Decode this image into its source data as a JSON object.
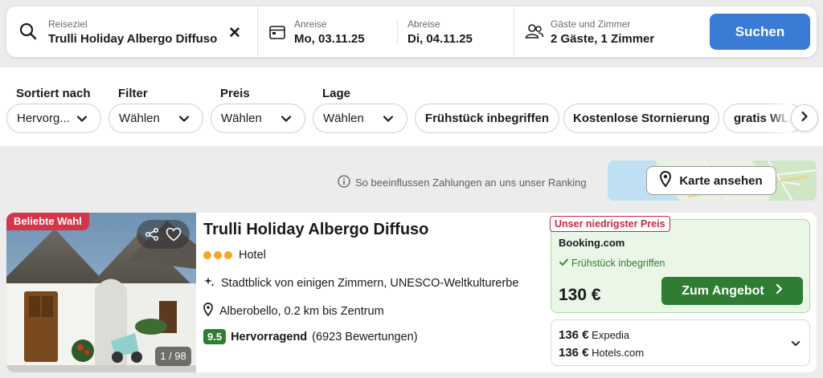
{
  "search": {
    "destination_label": "Reiseziel",
    "destination_value": "Trulli Holiday Albergo Diffuso",
    "checkin_label": "Anreise",
    "checkin_value": "Mo, 03.11.25",
    "checkout_label": "Abreise",
    "checkout_value": "Di, 04.11.25",
    "guests_label": "Gäste und Zimmer",
    "guests_value": "2 Gäste, 1 Zimmer",
    "button": "Suchen"
  },
  "filters": {
    "sort": {
      "label": "Sortiert nach",
      "value": "Hervorg..."
    },
    "filter": {
      "label": "Filter",
      "value": "Wählen"
    },
    "price": {
      "label": "Preis",
      "value": "Wählen"
    },
    "location": {
      "label": "Lage",
      "value": "Wählen"
    },
    "chips": [
      "Frühstück inbegriffen",
      "Kostenlose Stornierung",
      "gratis WLAN"
    ]
  },
  "ranking_info": "So beeinflussen Zahlungen an uns unser Ranking",
  "map_button": "Karte ansehen",
  "hotel": {
    "badge": "Beliebte Wahl",
    "photo_count": "1 / 98",
    "name": "Trulli Holiday Albergo Diffuso",
    "stars": 3,
    "type": "Hotel",
    "feature": "Stadtblick von einigen Zimmern, UNESCO-Weltkulturerbe",
    "location": "Alberobello, 0.2 km bis Zentrum",
    "rating_score": "9.5",
    "rating_text": "Hervorragend",
    "rating_count": "(6923 Bewertungen)",
    "offer": {
      "tag": "Unser niedrigster Preis",
      "provider": "Booking.com",
      "perk": "Frühstück inbegriffen",
      "price": "130 €",
      "button": "Zum Angebot"
    },
    "alternatives": [
      {
        "price": "136 €",
        "provider": "Expedia"
      },
      {
        "price": "136 €",
        "provider": "Hotels.com"
      }
    ]
  },
  "colors": {
    "primary_blue": "#3a7bd5",
    "deal_green": "#2e7d32",
    "badge_red": "#d3364a",
    "star_orange": "#f5a623"
  }
}
